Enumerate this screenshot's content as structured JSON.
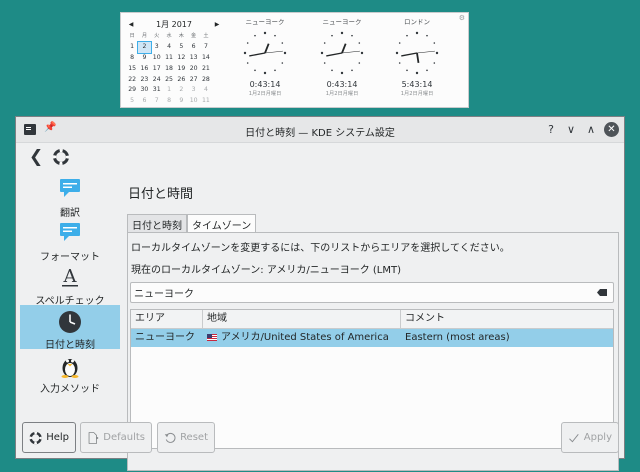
{
  "calendar": {
    "prev": "◀",
    "next": "▶",
    "month_label": "1月 2017",
    "weekdays": [
      "日",
      "月",
      "火",
      "水",
      "木",
      "金",
      "土"
    ],
    "weeks": [
      [
        "1",
        "2",
        "3",
        "4",
        "5",
        "6",
        "7"
      ],
      [
        "8",
        "9",
        "10",
        "11",
        "12",
        "13",
        "14"
      ],
      [
        "15",
        "16",
        "17",
        "18",
        "19",
        "20",
        "21"
      ],
      [
        "22",
        "23",
        "24",
        "25",
        "26",
        "27",
        "28"
      ],
      [
        "29",
        "30",
        "31",
        "1",
        "2",
        "3",
        "4"
      ],
      [
        "5",
        "6",
        "7",
        "8",
        "9",
        "10",
        "11"
      ]
    ],
    "today": "2"
  },
  "clocks": [
    {
      "city": "ニューヨーク",
      "time": "0:43:14",
      "date": "1月2日月曜日"
    },
    {
      "city": "ニューヨーク",
      "time": "0:43:14",
      "date": "1月2日月曜日"
    },
    {
      "city": "ロンドン",
      "time": "5:43:14",
      "date": "1月2日月曜日"
    }
  ],
  "window": {
    "title": "日付と時刻 — KDE システム設定",
    "buttons": {
      "help": "?",
      "minimize": "∨",
      "maximize": "∧",
      "close": "✕"
    }
  },
  "sidebar": {
    "items": [
      {
        "label": "翻訳",
        "icon": "translate-icon"
      },
      {
        "label": "フォーマット",
        "icon": "format-icon"
      },
      {
        "label": "スペルチェック",
        "icon": "spellcheck-icon"
      },
      {
        "label": "日付と時刻",
        "icon": "clock-icon",
        "selected": true
      },
      {
        "label": "入力メソッド",
        "icon": "tux-icon"
      }
    ]
  },
  "content": {
    "page_title": "日付と時間",
    "tabs": [
      {
        "label": "日付と時刻",
        "active": false
      },
      {
        "label": "タイムゾーン",
        "active": true
      }
    ],
    "instruction": "ローカルタイムゾーンを変更するには、下のリストからエリアを選択してください。",
    "current_zone": "現在のローカルタイムゾーン: アメリカ/ニューヨーク (LMT)",
    "search_value": "ニューヨーク",
    "table": {
      "headers": [
        "エリア",
        "地域",
        "コメント"
      ],
      "rows": [
        {
          "area": "ニューヨーク",
          "region": "アメリカ/United States of America",
          "comment": "Eastern (most areas)",
          "selected": true
        }
      ]
    }
  },
  "footer": {
    "help": "Help",
    "defaults": "Defaults",
    "reset": "Reset",
    "apply": "Apply"
  },
  "colors": {
    "desktop": "#1e8b86",
    "selection": "#93cee9",
    "accent": "#3daee9"
  }
}
